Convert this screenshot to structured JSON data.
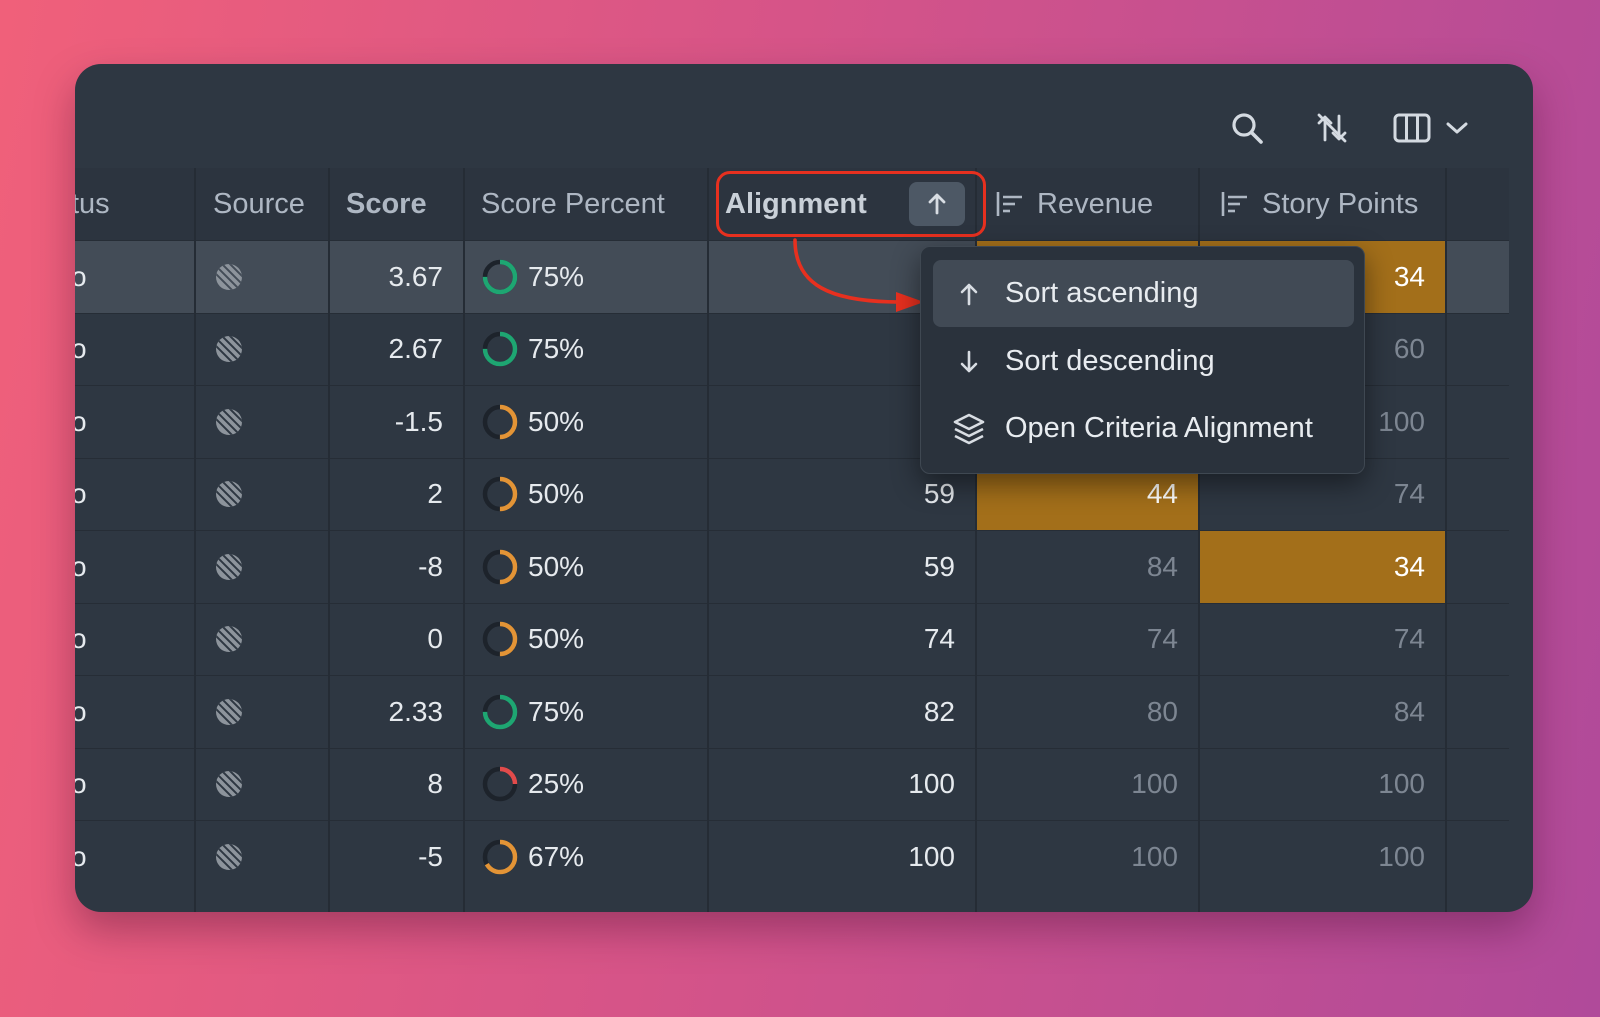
{
  "toolbar": {
    "icons": [
      "search-icon",
      "sort-off-icon",
      "columns-icon",
      "chevron-down-icon"
    ]
  },
  "columns": {
    "status": "tus",
    "source": "Source",
    "score": "Score",
    "score_percent": "Score Percent",
    "alignment": "Alignment",
    "revenue": "Revenue",
    "story_points": "Story Points"
  },
  "colors": {
    "accent_green": "#1ea672",
    "accent_orange": "#e39436",
    "accent_red": "#e24b4b",
    "highlight_cell": "#a36f1a",
    "annotation_red": "#e7301f"
  },
  "rows": [
    {
      "status": "o",
      "score": "3.67",
      "pct_label": "75%",
      "pct": 0.75,
      "pct_color": "green",
      "alignment": "",
      "revenue": "",
      "story_points": "34",
      "revenue_hl": true,
      "story_hl": true,
      "selected": true
    },
    {
      "status": "o",
      "score": "2.67",
      "pct_label": "75%",
      "pct": 0.75,
      "pct_color": "green",
      "alignment": "",
      "revenue": "",
      "story_points": "60"
    },
    {
      "status": "o",
      "score": "-1.5",
      "pct_label": "50%",
      "pct": 0.5,
      "pct_color": "orange",
      "alignment": "",
      "revenue": "",
      "story_points": "100"
    },
    {
      "status": "o",
      "score": "2",
      "pct_label": "50%",
      "pct": 0.5,
      "pct_color": "orange",
      "alignment": "59",
      "revenue": "44",
      "story_points": "74",
      "revenue_hl": true
    },
    {
      "status": "o",
      "score": "-8",
      "pct_label": "50%",
      "pct": 0.5,
      "pct_color": "orange",
      "alignment": "59",
      "revenue": "84",
      "story_points": "34",
      "story_hl": true
    },
    {
      "status": "o",
      "score": "0",
      "pct_label": "50%",
      "pct": 0.5,
      "pct_color": "orange",
      "alignment": "74",
      "revenue": "74",
      "story_points": "74"
    },
    {
      "status": "o",
      "score": "2.33",
      "pct_label": "75%",
      "pct": 0.75,
      "pct_color": "green",
      "alignment": "82",
      "revenue": "80",
      "story_points": "84"
    },
    {
      "status": "o",
      "score": "8",
      "pct_label": "25%",
      "pct": 0.25,
      "pct_color": "red",
      "alignment": "100",
      "revenue": "100",
      "story_points": "100"
    },
    {
      "status": "o",
      "score": "-5",
      "pct_label": "67%",
      "pct": 0.67,
      "pct_color": "orange",
      "alignment": "100",
      "revenue": "100",
      "story_points": "100"
    }
  ],
  "sort_menu": {
    "items": [
      {
        "label": "Sort ascending",
        "icon": "arrow-up-icon",
        "active": true
      },
      {
        "label": "Sort descending",
        "icon": "arrow-down-icon",
        "active": false
      },
      {
        "label": "Open Criteria Alignment",
        "icon": "layers-icon",
        "active": false
      }
    ]
  }
}
